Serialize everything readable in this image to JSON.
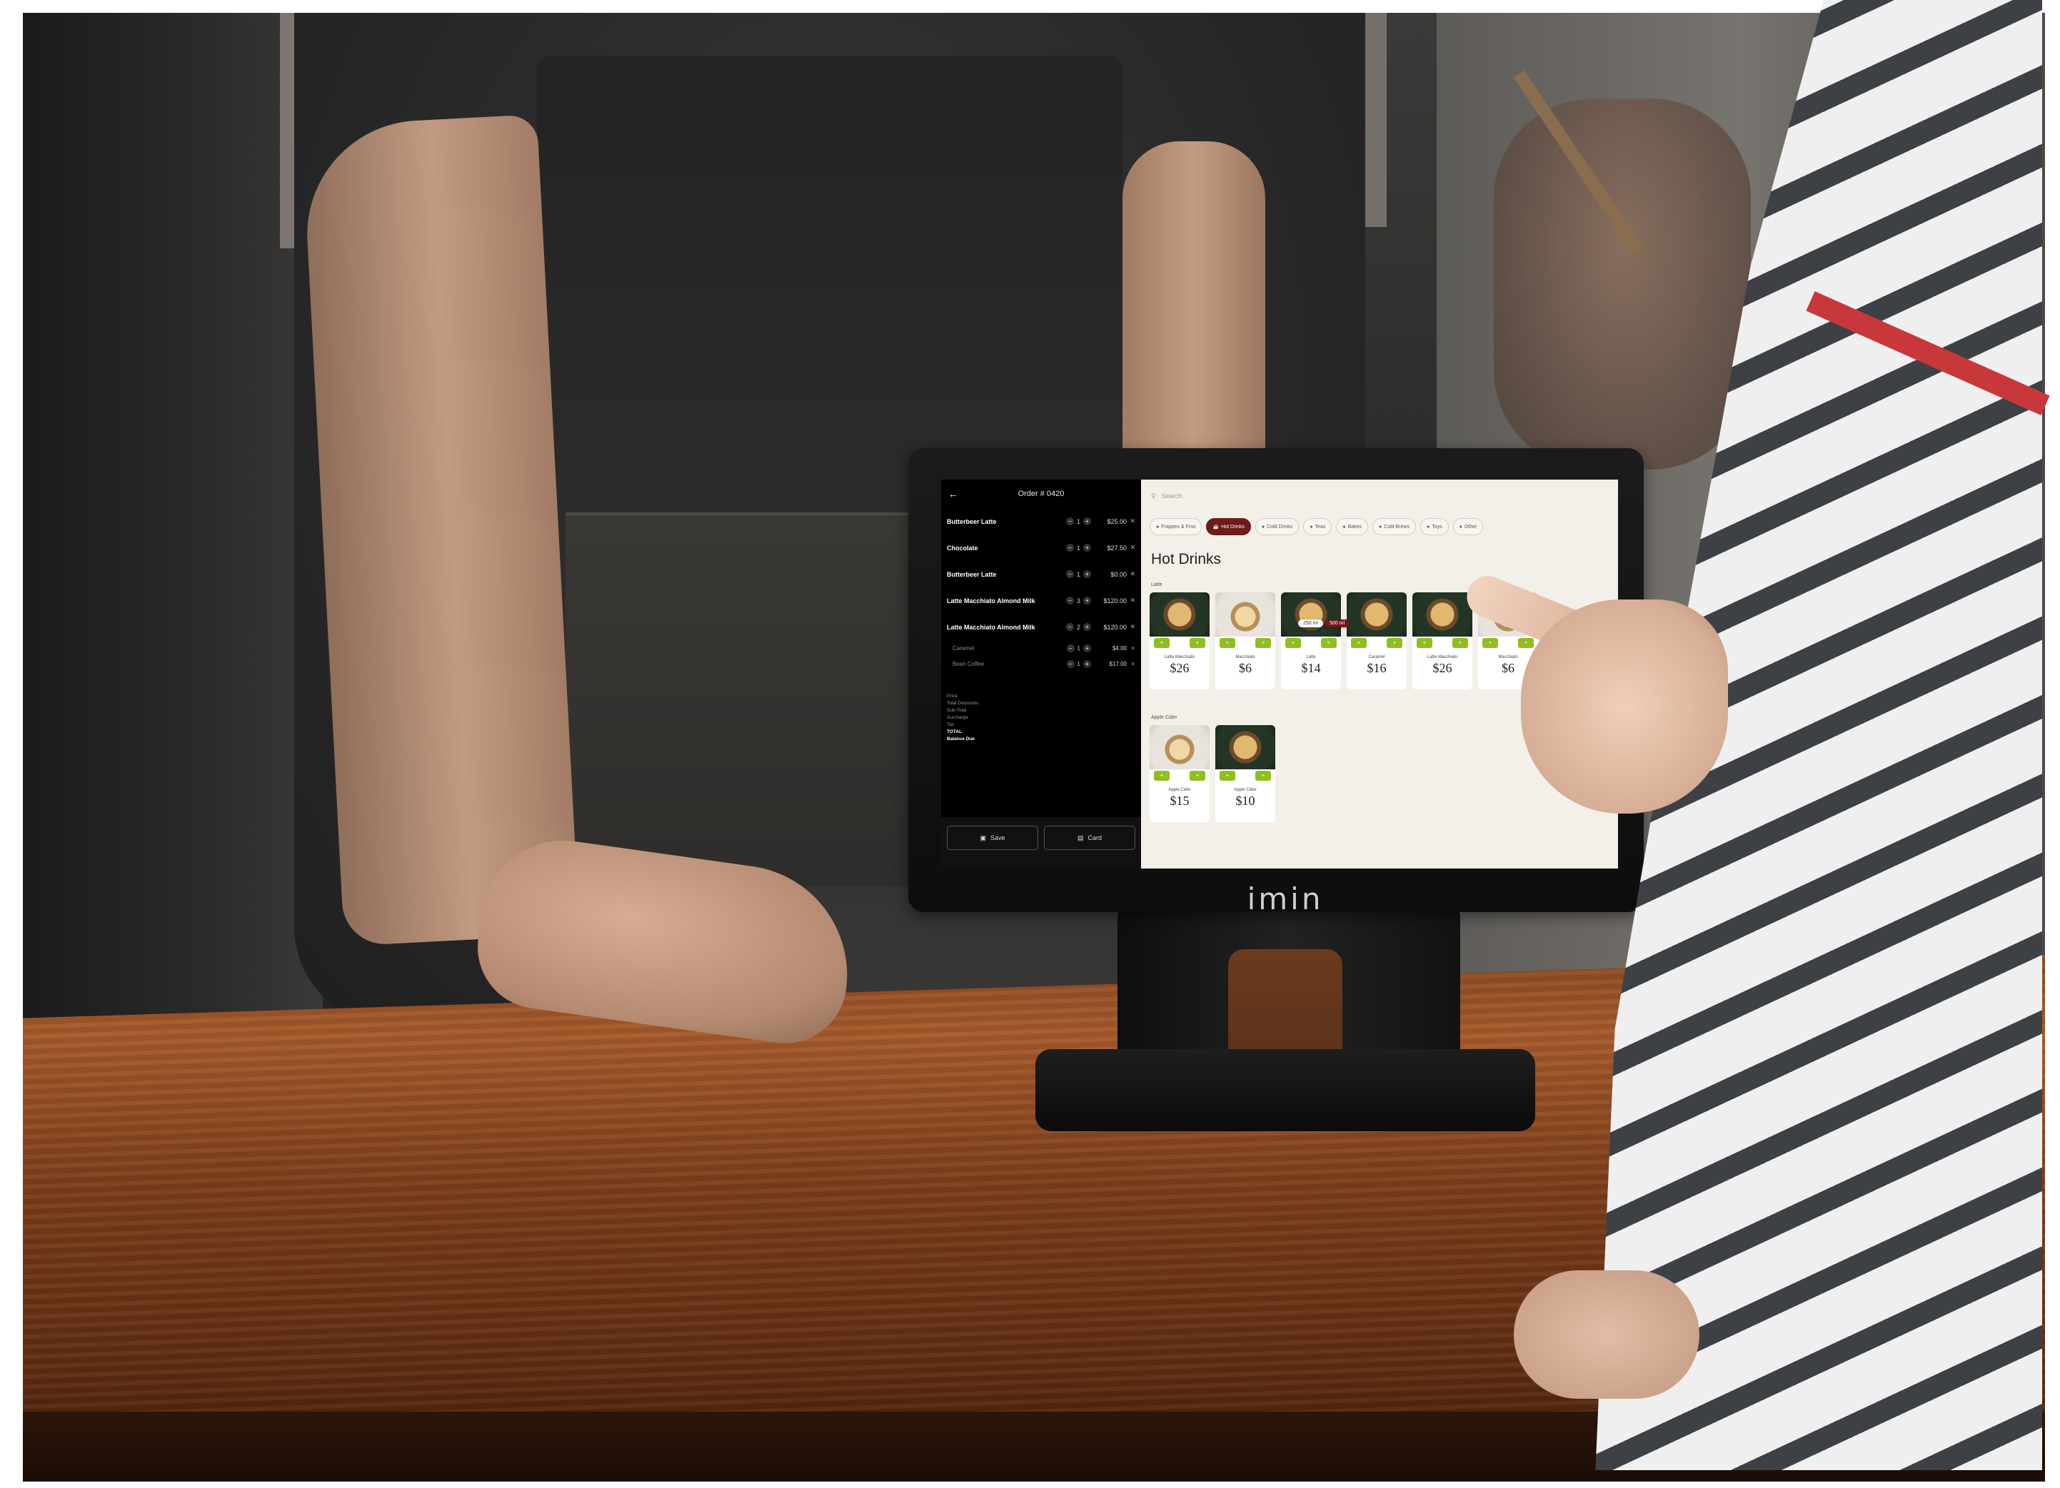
{
  "brand": {
    "logo_text": "imin"
  },
  "pos": {
    "order": {
      "title": "Order # 0420",
      "items": [
        {
          "name": "Butterbeer Latte",
          "qty": "1",
          "price": "$25.00"
        },
        {
          "name": "Chocolate",
          "qty": "1",
          "price": "$27.50"
        },
        {
          "name": "Butterbeer Latte",
          "qty": "1",
          "price": "$0.00"
        },
        {
          "name": "Latte Macchiato Almond Milk",
          "qty": "3",
          "price": "$120.00"
        },
        {
          "name": "Latte Macchiato Almond Milk",
          "qty": "2",
          "price": "$120.00"
        }
      ],
      "sub_items": [
        {
          "name": "Caramel",
          "qty": "1",
          "price": "$4.00"
        },
        {
          "name": "Bean Coffee",
          "qty": "1",
          "price": "$17.00"
        }
      ],
      "summary": [
        {
          "label": "Price",
          "value": ""
        },
        {
          "label": "Total Discounts",
          "value": ""
        },
        {
          "label": "Sub-Total",
          "value": ""
        },
        {
          "label": "Surcharge",
          "value": ""
        },
        {
          "label": "Tax",
          "value": ""
        },
        {
          "label": "TOTAL",
          "value": ""
        },
        {
          "label": "Balance Due",
          "value": ""
        }
      ],
      "buttons": {
        "save": "Save",
        "card": "Card"
      }
    },
    "menu": {
      "search_placeholder": "Search",
      "categories": [
        "Frappes & Fros",
        "Hot Drinks",
        "Cold Drinks",
        "Teas",
        "Bakes",
        "Cold Brews",
        "Toys",
        "Other"
      ],
      "active_category": "Hot Drinks",
      "section_title": "Hot Drinks",
      "groups": [
        {
          "label": "Latte",
          "products": [
            {
              "name": "Latte Macchiato",
              "price": "$26"
            },
            {
              "name": "Macchiato",
              "price": "$6"
            },
            {
              "name": "Latte",
              "price": "$14"
            },
            {
              "name": "Caramel",
              "price": "$16"
            },
            {
              "name": "Latte Macchiato",
              "price": "$26"
            },
            {
              "name": "Macchiato",
              "price": "$6"
            }
          ]
        },
        {
          "label": "Apple Cider",
          "products": [
            {
              "name": "Apple Cider",
              "price": "$15"
            },
            {
              "name": "Apple Cider",
              "price": "$10"
            }
          ]
        }
      ],
      "size_options": [
        "250 ml",
        "500 ml"
      ]
    }
  }
}
